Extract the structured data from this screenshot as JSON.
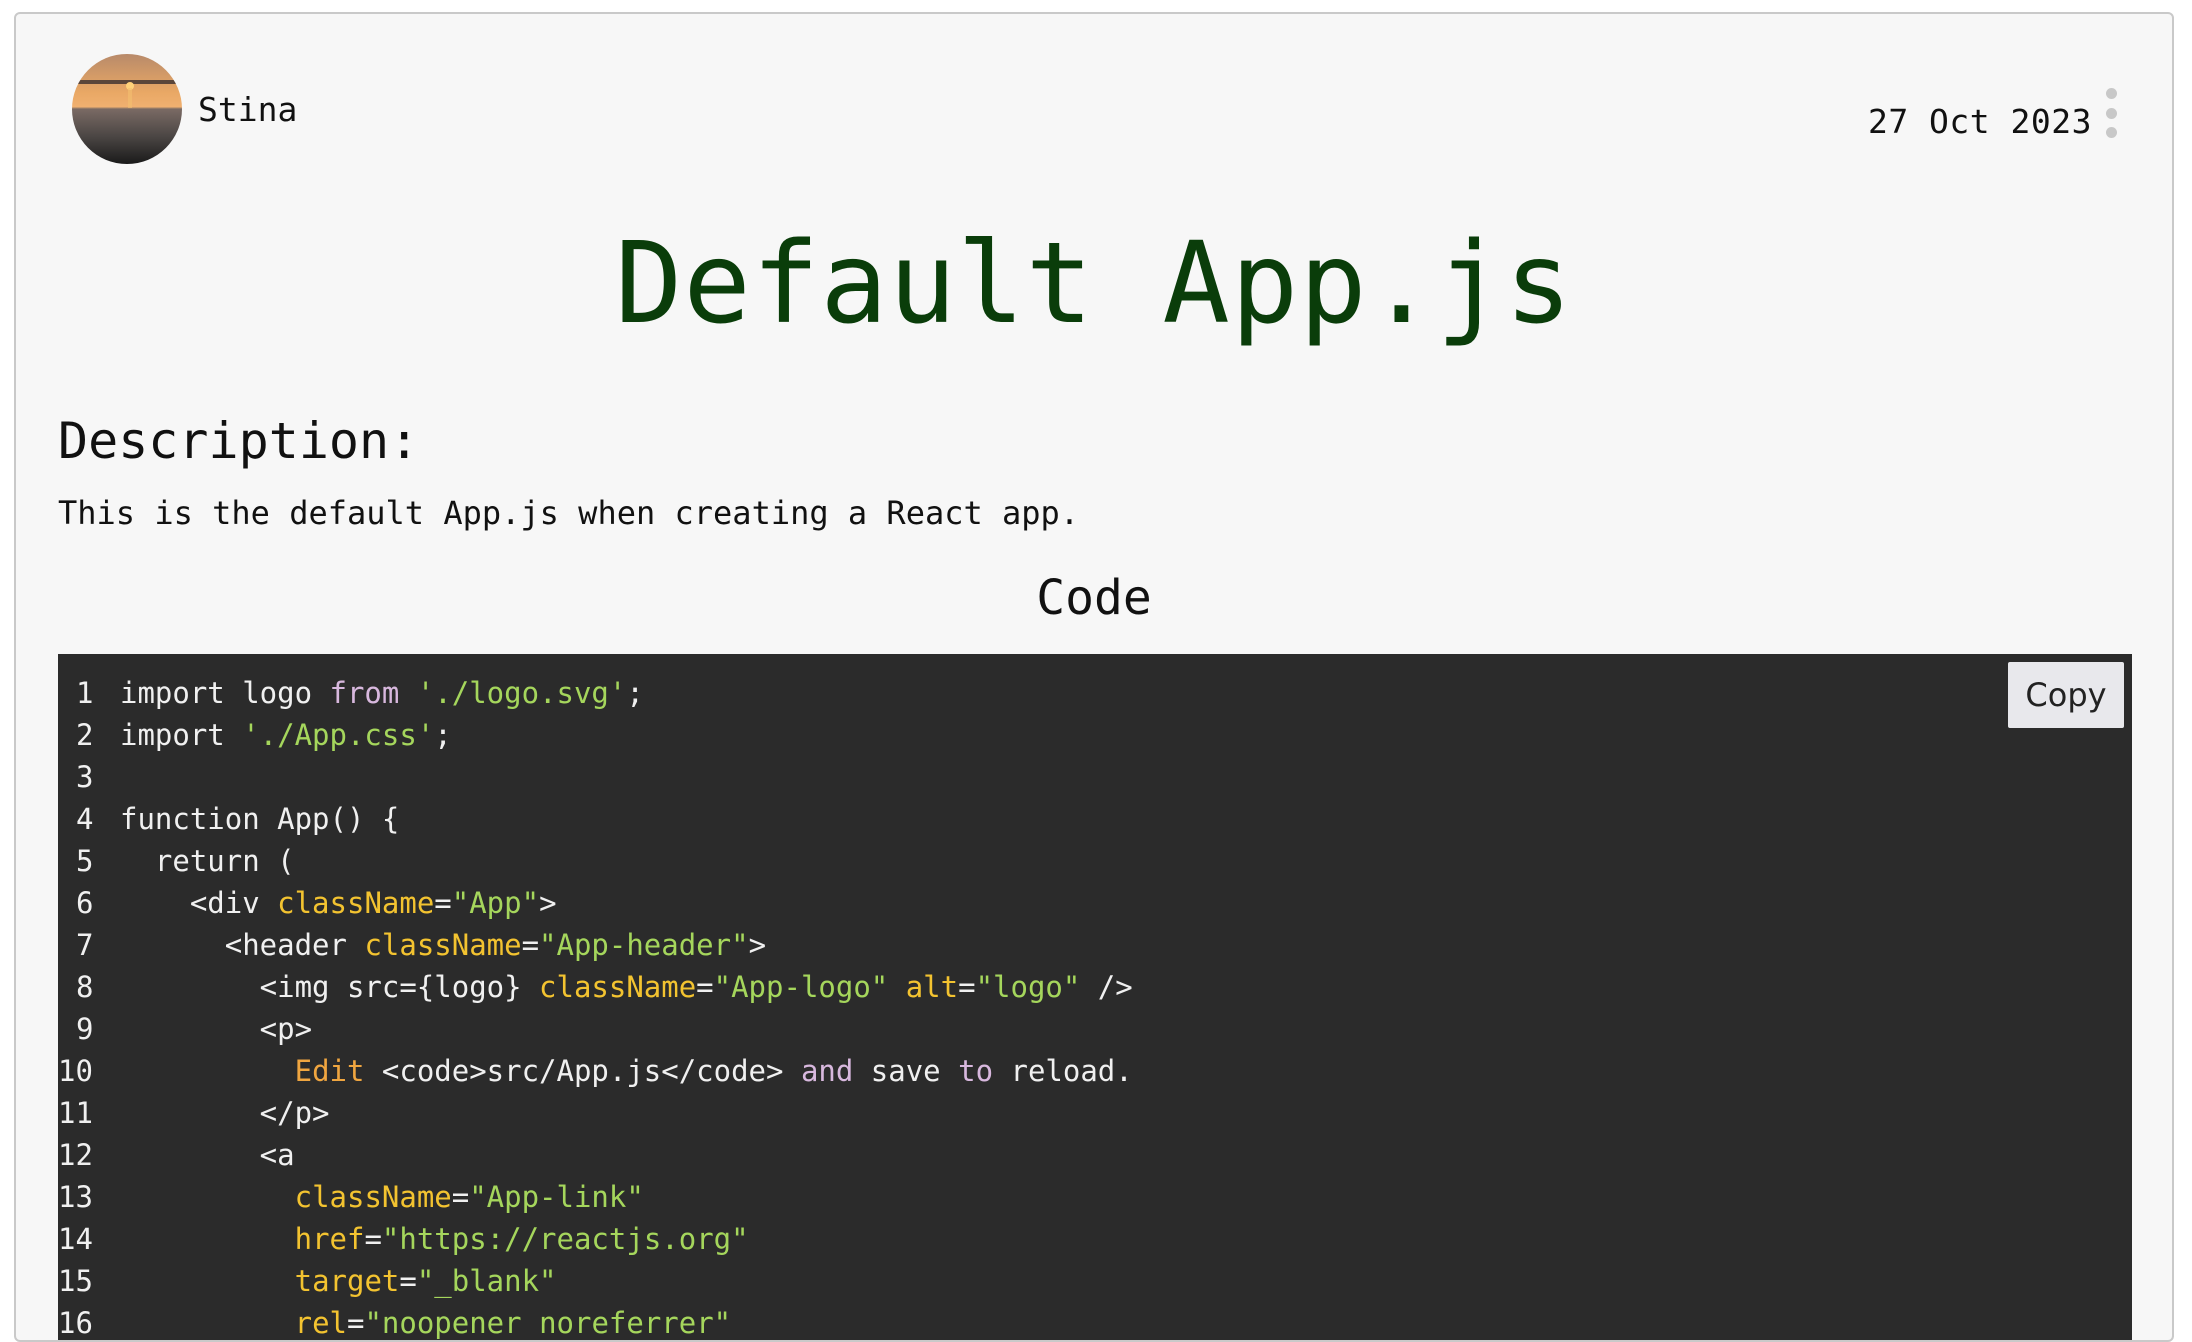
{
  "post": {
    "author": "Stina",
    "date": "27 Oct 2023",
    "title": "Default App.js",
    "description_heading": "Description:",
    "description": "This is the default App.js when creating a React app.",
    "code_heading": "Code",
    "copy_label": "Copy"
  },
  "icons": {
    "avatar": "sunset-photo-avatar",
    "menu": "kebab-menu-icon"
  },
  "colors": {
    "title": "#0a3d0a",
    "code_bg": "#2b2b2b",
    "string": "#a5d65c",
    "attribute": "#f3c330",
    "keyword_soft": "#d8b8de",
    "jsx_text_orange": "#f0a640"
  },
  "code": {
    "line_numbers": [
      "1",
      "2",
      "3",
      "4",
      "5",
      "6",
      "7",
      "8",
      "9",
      "10",
      "11",
      "12",
      "13",
      "14",
      "15",
      "16"
    ],
    "lines": [
      [
        {
          "t": "import logo ",
          "c": "plain"
        },
        {
          "t": "from",
          "c": "from"
        },
        {
          "t": " ",
          "c": "plain"
        },
        {
          "t": "'./logo.svg'",
          "c": "str"
        },
        {
          "t": ";",
          "c": "plain"
        }
      ],
      [
        {
          "t": "import ",
          "c": "plain"
        },
        {
          "t": "'./App.css'",
          "c": "str"
        },
        {
          "t": ";",
          "c": "plain"
        }
      ],
      [],
      [
        {
          "t": "function App() {",
          "c": "plain"
        }
      ],
      [
        {
          "t": "  return (",
          "c": "plain"
        }
      ],
      [
        {
          "t": "    <div ",
          "c": "plain"
        },
        {
          "t": "className",
          "c": "attr"
        },
        {
          "t": "=",
          "c": "plain"
        },
        {
          "t": "\"App\"",
          "c": "str"
        },
        {
          "t": ">",
          "c": "plain"
        }
      ],
      [
        {
          "t": "      <header ",
          "c": "plain"
        },
        {
          "t": "className",
          "c": "attr"
        },
        {
          "t": "=",
          "c": "plain"
        },
        {
          "t": "\"App-header\"",
          "c": "str"
        },
        {
          "t": ">",
          "c": "plain"
        }
      ],
      [
        {
          "t": "        <img src={logo} ",
          "c": "plain"
        },
        {
          "t": "className",
          "c": "attr"
        },
        {
          "t": "=",
          "c": "plain"
        },
        {
          "t": "\"App-logo\"",
          "c": "str"
        },
        {
          "t": " ",
          "c": "plain"
        },
        {
          "t": "alt",
          "c": "attr"
        },
        {
          "t": "=",
          "c": "plain"
        },
        {
          "t": "\"logo\"",
          "c": "str"
        },
        {
          "t": " />",
          "c": "plain"
        }
      ],
      [
        {
          "t": "        <p>",
          "c": "plain"
        }
      ],
      [
        {
          "t": "          ",
          "c": "plain"
        },
        {
          "t": "Edit",
          "c": "edit"
        },
        {
          "t": " <code>src/App.js</code> ",
          "c": "plain"
        },
        {
          "t": "and",
          "c": "from"
        },
        {
          "t": " save ",
          "c": "plain"
        },
        {
          "t": "to",
          "c": "from"
        },
        {
          "t": " reload.",
          "c": "plain"
        }
      ],
      [
        {
          "t": "        </p>",
          "c": "plain"
        }
      ],
      [
        {
          "t": "        <a",
          "c": "plain"
        }
      ],
      [
        {
          "t": "          ",
          "c": "plain"
        },
        {
          "t": "className",
          "c": "attr"
        },
        {
          "t": "=",
          "c": "plain"
        },
        {
          "t": "\"App-link\"",
          "c": "str"
        }
      ],
      [
        {
          "t": "          ",
          "c": "plain"
        },
        {
          "t": "href",
          "c": "attr"
        },
        {
          "t": "=",
          "c": "plain"
        },
        {
          "t": "\"https://reactjs.org\"",
          "c": "str"
        }
      ],
      [
        {
          "t": "          ",
          "c": "plain"
        },
        {
          "t": "target",
          "c": "attr"
        },
        {
          "t": "=",
          "c": "plain"
        },
        {
          "t": "\"_blank\"",
          "c": "str"
        }
      ],
      [
        {
          "t": "          ",
          "c": "plain"
        },
        {
          "t": "rel",
          "c": "attr"
        },
        {
          "t": "=",
          "c": "plain"
        },
        {
          "t": "\"noopener noreferrer\"",
          "c": "str"
        }
      ]
    ]
  }
}
